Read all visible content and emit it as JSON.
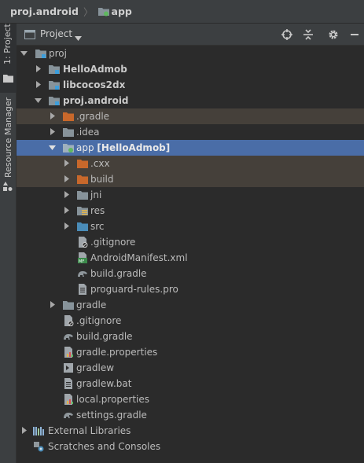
{
  "breadcrumb": {
    "root": "proj.android",
    "separator": "〉",
    "current": "app"
  },
  "side_tabs": {
    "project": "1: Project",
    "resource_manager": "Resource Manager"
  },
  "panel": {
    "title": "Project",
    "dropdown_icon": "chevron-down-icon"
  },
  "tree": {
    "root": "proj",
    "hello_admob": "HelloAdmob",
    "libcocos2dx": "libcocos2dx",
    "proj_android": "proj.android",
    "gradle_dir": ".gradle",
    "idea_dir": ".idea",
    "app": "app",
    "app_module": "[HelloAdmob]",
    "cxx": ".cxx",
    "build": "build",
    "jni": "jni",
    "res": "res",
    "src": "src",
    "app_gitignore": ".gitignore",
    "manifest": "AndroidManifest.xml",
    "app_build_gradle": "build.gradle",
    "proguard": "proguard-rules.pro",
    "gradle": "gradle",
    "gitignore": ".gitignore",
    "build_gradle": "build.gradle",
    "gradle_properties": "gradle.properties",
    "gradlew": "gradlew",
    "gradlew_bat": "gradlew.bat",
    "local_properties": "local.properties",
    "settings_gradle": "settings.gradle",
    "external_libraries": "External Libraries",
    "scratches": "Scratches and Consoles"
  },
  "colors": {
    "selection": "#4a6da7",
    "excluded_bg": "#45403a",
    "folder": "#87939a",
    "excluded_folder": "#c8682b",
    "source_folder": "#4a8cb8",
    "module_badge": "#3d9edb"
  }
}
